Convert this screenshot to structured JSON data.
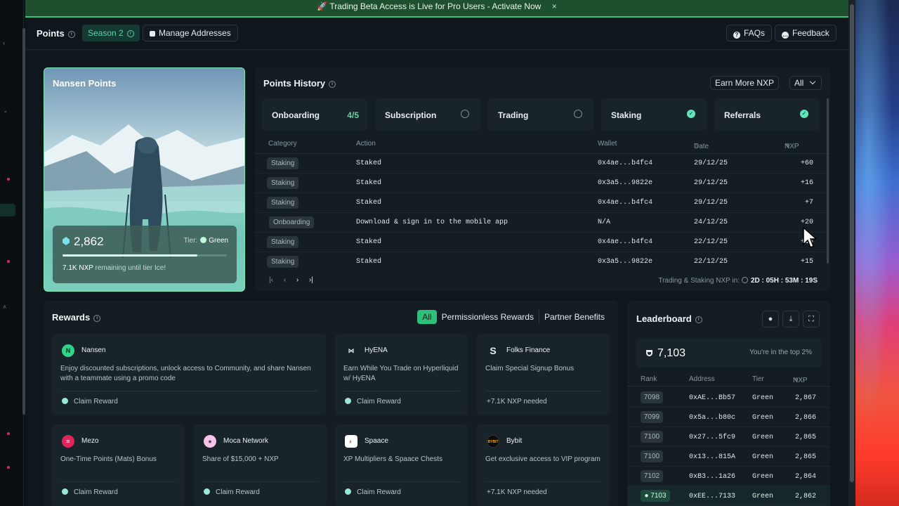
{
  "banner": {
    "icon": "rocket-icon",
    "text": "🚀 Trading Beta Access is Live for Pro Users - Activate Now",
    "close": "×"
  },
  "topbar": {
    "title": "Points",
    "season": "Season 2",
    "manage": "Manage Addresses",
    "faqs": "FAQs",
    "feedback": "Feedback"
  },
  "nansen_card": {
    "title": "Nansen Points",
    "points": "2,862",
    "tier_label": "Tier:",
    "tier": "Green",
    "remaining_amount": "7.1K NXP",
    "remaining_text": "remaining until tier Ice!",
    "progress_fraction": 0.82
  },
  "history": {
    "title": "Points History",
    "earn_more": "Earn More NXP",
    "filter": "All",
    "tabs": [
      {
        "label": "Onboarding",
        "progress": "4/5",
        "state": "progress"
      },
      {
        "label": "Subscription",
        "state": "empty"
      },
      {
        "label": "Trading",
        "state": "empty"
      },
      {
        "label": "Staking",
        "state": "done"
      },
      {
        "label": "Referrals",
        "state": "done"
      }
    ],
    "columns": {
      "category": "Category",
      "action": "Action",
      "wallet": "Wallet",
      "date": "Date",
      "nxp": "NXP"
    },
    "rows": [
      {
        "category": "Staking",
        "action": "Staked",
        "wallet": "0x4ae...b4fc4",
        "date": "29/12/25",
        "nxp": "+60"
      },
      {
        "category": "Staking",
        "action": "Staked",
        "wallet": "0x3a5...9822e",
        "date": "29/12/25",
        "nxp": "+16"
      },
      {
        "category": "Staking",
        "action": "Staked",
        "wallet": "0x4ae...b4fc4",
        "date": "29/12/25",
        "nxp": "+7"
      },
      {
        "category": "Onboarding",
        "action": "Download & sign in to the mobile app",
        "wallet": "N/A",
        "date": "24/12/25",
        "nxp": "+20"
      },
      {
        "category": "Staking",
        "action": "Staked",
        "wallet": "0x4ae...b4fc4",
        "date": "22/12/25",
        "nxp": "+15"
      },
      {
        "category": "Staking",
        "action": "Staked",
        "wallet": "0x3a5...9822e",
        "date": "22/12/25",
        "nxp": "+15"
      }
    ],
    "pager": {
      "first": "|‹",
      "prev": "‹",
      "next": "›",
      "last": "›|"
    },
    "countdown_label": "Trading & Staking NXP in:",
    "countdown": "2D : 05H : 53M : 19S"
  },
  "rewards": {
    "title": "Rewards",
    "filters": [
      "All",
      "Permissionless Rewards",
      "Partner Benefits"
    ],
    "cards": [
      {
        "name": "Nansen",
        "desc": "Enjoy discounted subscriptions, unlock access to Community, and share Nansen with a teammate using a promo code",
        "action": "Claim Reward",
        "icon": "nansen-logo-icon",
        "color": "#2fd58a"
      },
      {
        "name": "HyENA",
        "desc": "Earn While You Trade on Hyperliquid w/ HyENA",
        "action": "Claim Reward",
        "icon": "hyena-logo-icon",
        "color": "#e8eef0"
      },
      {
        "name": "Folks Finance",
        "desc": "Claim Special Signup Bonus",
        "action": "+7.1K NXP needed",
        "icon": "folks-logo-icon",
        "color": "#e8eef0"
      },
      {
        "name": "Mezo",
        "desc": "One-Time Points (Mats) Bonus",
        "action": "Claim Reward",
        "icon": "mezo-logo-icon",
        "color": "#e0245e"
      },
      {
        "name": "Moca Network",
        "desc": "Share of $15,000 + NXP",
        "action": "Claim Reward",
        "icon": "moca-logo-icon",
        "color": "#f3c4e8"
      },
      {
        "name": "Spaace",
        "desc": "XP Multipliers & Spaace Chests",
        "action": "Claim Reward",
        "icon": "spaace-logo-icon",
        "color": "#ff4b4b"
      },
      {
        "name": "Bybit",
        "desc": "Get exclusive access to VIP program",
        "action": "+7.1K NXP needed",
        "icon": "bybit-logo-icon",
        "color": "#111111"
      }
    ]
  },
  "leaderboard": {
    "title": "Leaderboard",
    "my_rank": "7,103",
    "top_text": "You're in the top 2%",
    "columns": {
      "rank": "Rank",
      "address": "Address",
      "tier": "Tier",
      "nxp": "NXP"
    },
    "rows": [
      {
        "rank": "7098",
        "address": "0xAE...Bb57",
        "tier": "Green",
        "nxp": "2,867"
      },
      {
        "rank": "7099",
        "address": "0x5a...b80c",
        "tier": "Green",
        "nxp": "2,866"
      },
      {
        "rank": "7100",
        "address": "0x27...5fc9",
        "tier": "Green",
        "nxp": "2,865"
      },
      {
        "rank": "7100",
        "address": "0x13...815A",
        "tier": "Green",
        "nxp": "2,865"
      },
      {
        "rank": "7102",
        "address": "0xB3...1a26",
        "tier": "Green",
        "nxp": "2,864"
      },
      {
        "rank": "7103",
        "address": "0xEE...7133",
        "tier": "Green",
        "nxp": "2,862",
        "me": true
      }
    ]
  }
}
